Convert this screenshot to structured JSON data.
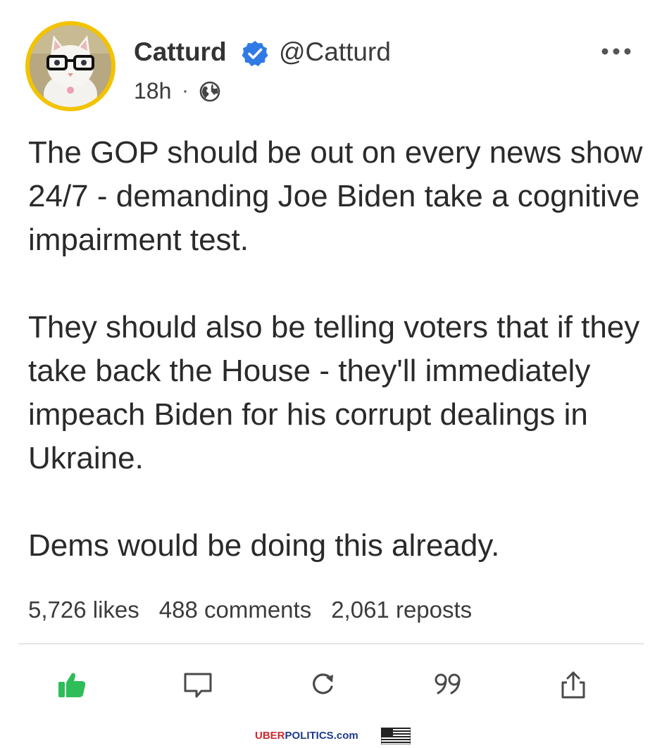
{
  "post": {
    "author": {
      "display_name": "Catturd",
      "handle": "@Catturd",
      "verified": true,
      "avatar_icon": "cat-with-glasses-avatar"
    },
    "time": "18h",
    "time_separator": "·",
    "visibility_icon": "globe-icon",
    "paragraphs": [
      "The GOP should be out on every news show 24/7 - demanding Joe Biden take a cognitive impairment test.",
      "They should also be telling voters that if they take back the House - they'll immediately impeach Biden for his corrupt dealings in Ukraine.",
      "Dems would be doing this already."
    ],
    "stats": {
      "likes": "5,726 likes",
      "comments": "488 comments",
      "reposts": "2,061 reposts"
    }
  },
  "actions": [
    {
      "name": "like",
      "icon": "thumbs-up-icon"
    },
    {
      "name": "comment",
      "icon": "comment-icon"
    },
    {
      "name": "repost",
      "icon": "repost-icon"
    },
    {
      "name": "quote",
      "icon": "quote-icon"
    },
    {
      "name": "share",
      "icon": "share-icon"
    }
  ],
  "watermark": {
    "brand_part1": "UBER",
    "brand_part2": "POLITICS",
    "brand_part3": ".com"
  },
  "colors": {
    "accent_green": "#2ebd59",
    "verified_blue": "#2f7ae5",
    "avatar_ring": "#f3c300",
    "text": "#2a2a2a",
    "icon_gray": "#4a4a4a"
  }
}
